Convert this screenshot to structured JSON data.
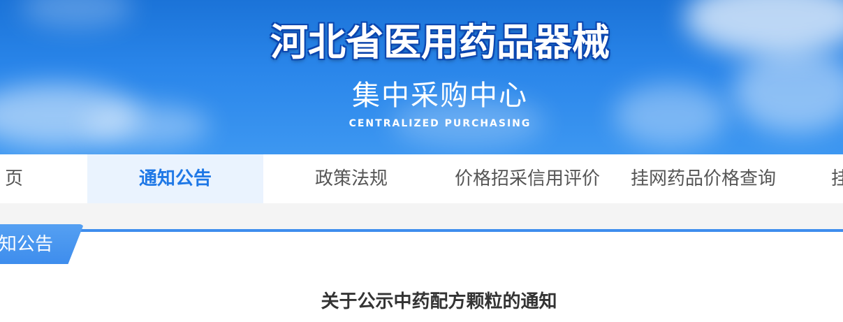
{
  "banner": {
    "title": "河北省医用药品器械",
    "subtitle": "集中采购中心",
    "subtitle_en": "CENTRALIZED PURCHASING"
  },
  "nav": {
    "items": [
      {
        "label": "页"
      },
      {
        "label": "通知公告"
      },
      {
        "label": "政策法规"
      },
      {
        "label": "价格招采信用评价"
      },
      {
        "label": "挂网药品价格查询"
      },
      {
        "label": "挂"
      }
    ]
  },
  "section": {
    "label": "知公告"
  },
  "article": {
    "title": "关于公示中药配方颗粒的通知"
  },
  "colors": {
    "accent": "#3e8ded",
    "active_text": "#1f78e6",
    "active_bg": "#eaf3fe"
  }
}
